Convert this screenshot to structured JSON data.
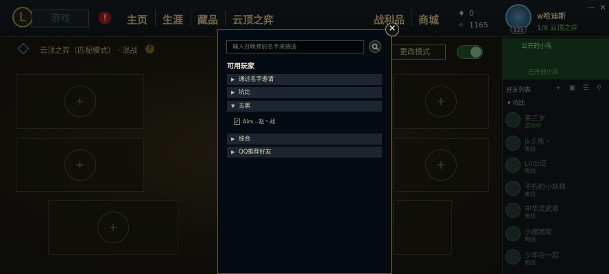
{
  "topbar": {
    "logo_letter": "L",
    "play_label": "游戏",
    "alert_symbol": "!",
    "nav": [
      "主页",
      "生涯",
      "藏品",
      "云顶之弈"
    ],
    "nav_right": [
      "战利品",
      "商城"
    ],
    "currency_be": "0",
    "currency_rp": "1165",
    "username": "w哈迪斯",
    "user_status": "1/8 云顶之弈",
    "level": "125",
    "min_label": "—",
    "close_label": "✕"
  },
  "lobby": {
    "mode_text": "云顶之弈（匹配模式） · 混战",
    "help_symbol": "?",
    "change_mode_label": "更改模式",
    "plus_symbol": "+"
  },
  "social": {
    "party_title": "公开的小队",
    "party_sub": "已开放小队",
    "friends_title": "好友列表",
    "group_label": "坑比",
    "friends": [
      {
        "name": "美三岁",
        "status": "游戏中"
      },
      {
        "name": "jk彡熊丶",
        "status": "离线"
      },
      {
        "name": "LII出征",
        "status": "离线"
      },
      {
        "name": "不朽的小妖精",
        "status": "离线"
      },
      {
        "name": "中华灵武郎",
        "status": "离线"
      },
      {
        "name": "小猪猪妮",
        "status": "离线"
      },
      {
        "name": "少年在一起",
        "status": "离线"
      }
    ]
  },
  "modal": {
    "search_placeholder": "输入召唤师的名字来筛选",
    "section_title": "可用玩家",
    "groups": [
      {
        "label": "通过名字邀请",
        "expanded": false
      },
      {
        "label": "坑比",
        "expanded": false
      },
      {
        "label": "五黑",
        "expanded": true
      },
      {
        "label": "综合",
        "expanded": false
      },
      {
        "label": "QQ推荐好友",
        "expanded": false
      }
    ],
    "member": {
      "name": "Airs…赵丶战",
      "checked": true
    },
    "close_symbol": "×"
  },
  "colors": {
    "accent_gold": "#6b5a2c",
    "modal_bg": "#050b12",
    "group_row_bg": "#1c2530"
  }
}
